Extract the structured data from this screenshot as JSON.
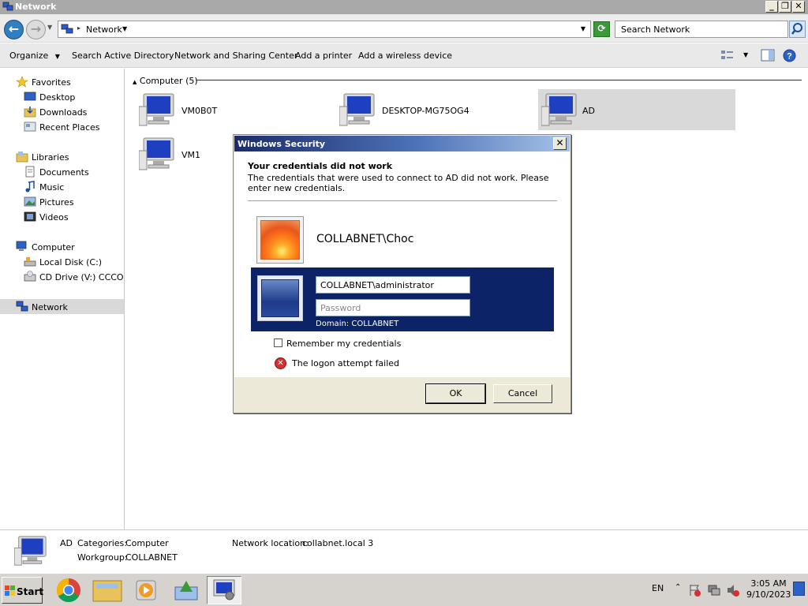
{
  "window": {
    "title": "Network"
  },
  "address": {
    "path": "Network",
    "search_placeholder": "Search Network"
  },
  "toolbar": {
    "organize": "Organize",
    "search_ad": "Search Active Directory",
    "network_center": "Network and Sharing Center",
    "add_printer": "Add a printer",
    "add_wireless": "Add a wireless device"
  },
  "nav": {
    "favorites": "Favorites",
    "desktop": "Desktop",
    "downloads": "Downloads",
    "recent": "Recent Places",
    "libraries": "Libraries",
    "documents": "Documents",
    "music": "Music",
    "pictures": "Pictures",
    "videos": "Videos",
    "computer": "Computer",
    "local_disk": "Local Disk (C:)",
    "cd_drive": "CD Drive (V:) CCCOMA",
    "network": "Network"
  },
  "content": {
    "group_header": "Computer (5)",
    "computers": [
      "VM0B0T",
      "DESKTOP-MG75OG4",
      "AD",
      "VM1"
    ]
  },
  "details": {
    "name": "AD",
    "categories_label": "Categories:",
    "categories_value": "Computer",
    "workgroup_label": "Workgroup:",
    "workgroup_value": "COLLABNET",
    "location_label": "Network location:",
    "location_value": "collabnet.local  3"
  },
  "dialog": {
    "title": "Windows Security",
    "heading": "Your credentials did not work",
    "message": "The credentials that were used to connect to AD did not work. Please enter new credentials.",
    "account1": "COLLABNET\\Choc",
    "username_value": "COLLABNET\\administrator",
    "password_placeholder": "Password",
    "domain": "Domain: COLLABNET",
    "remember": "Remember my credentials",
    "error": "The logon attempt failed",
    "ok": "OK",
    "cancel": "Cancel"
  },
  "taskbar": {
    "start": "Start",
    "lang": "EN",
    "time": "3:05 AM",
    "date": "9/10/2023"
  },
  "colors": {
    "dialog_title_start": "#1a2c6b",
    "selected_panel": "#0d2367",
    "monitor_blue": "#1e40c0"
  }
}
